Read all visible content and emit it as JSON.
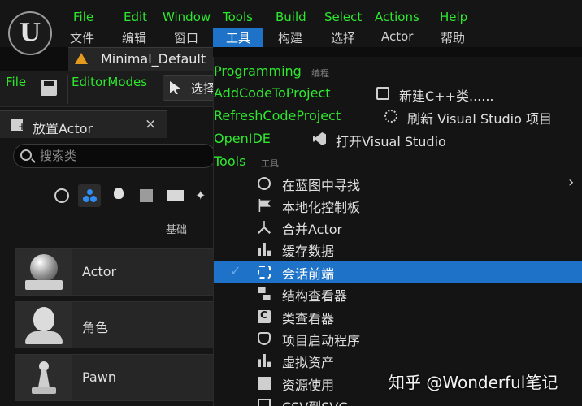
{
  "menubar": {
    "items": [
      {
        "en": "File",
        "zh": "文件"
      },
      {
        "en": "Edit",
        "zh": "编辑"
      },
      {
        "en": "Window",
        "zh": "窗口"
      },
      {
        "en": "Tools",
        "zh": "工具"
      },
      {
        "en": "Build",
        "zh": "构建"
      },
      {
        "en": "Select",
        "zh": "选择"
      },
      {
        "en": "Actions",
        "zh": "Actor"
      },
      {
        "en": "Help",
        "zh": "帮助"
      }
    ]
  },
  "level_tab": {
    "label": "Minimal_Default"
  },
  "toolbar": {
    "file_label": "File",
    "editormodes_label": "EditorModes",
    "select_label": "选择"
  },
  "place_panel": {
    "tab_title": "放置Actor",
    "close_glyph": "×",
    "search_placeholder": "搜索类",
    "category_label": "基础",
    "visual_glyph": "✦",
    "items": [
      {
        "label": "Actor"
      },
      {
        "label": "角色"
      },
      {
        "label": "Pawn"
      }
    ]
  },
  "dropdown": {
    "programming": {
      "en": "Programming",
      "zh": "编程"
    },
    "commands": [
      {
        "en": "AddCodeToProject",
        "zh": "新建C++类......",
        "icon": "add-class-icon"
      },
      {
        "en": "RefreshCodeProject",
        "zh": "刷新 Visual Studio 项目",
        "icon": "refresh-project-icon"
      },
      {
        "en": "OpenIDE",
        "zh": "打开Visual Studio",
        "icon": "visual-studio-icon"
      }
    ],
    "tools": {
      "en": "Tools",
      "zh": "工具"
    },
    "tool_items": [
      {
        "zh": "在蓝图中寻找",
        "icon": "find-in-blueprints-icon",
        "submenu": "›"
      },
      {
        "zh": "本地化控制板",
        "icon": "localization-dashboard-icon"
      },
      {
        "zh": "合并Actor",
        "icon": "merge-actors-icon"
      },
      {
        "zh": "缓存数据",
        "icon": "cache-statistics-icon"
      },
      {
        "zh": "会话前端",
        "icon": "session-frontend-icon",
        "check": "✓"
      },
      {
        "zh": "结构查看器",
        "icon": "struct-viewer-icon"
      },
      {
        "zh": "类查看器",
        "icon": "class-viewer-icon"
      },
      {
        "zh": "项目启动程序",
        "icon": "project-launcher-icon"
      },
      {
        "zh": "虚拟资产",
        "icon": "virtual-assets-icon"
      },
      {
        "zh": "资源使用",
        "icon": "resource-usage-icon"
      },
      {
        "zh": "CSV到SVG",
        "icon": "csv-to-svg-icon"
      }
    ]
  },
  "watermark": "知乎 @Wonderful笔记",
  "colors": {
    "accent": "#1e73c8",
    "green_label": "#2ee82e",
    "background": "#141414"
  }
}
